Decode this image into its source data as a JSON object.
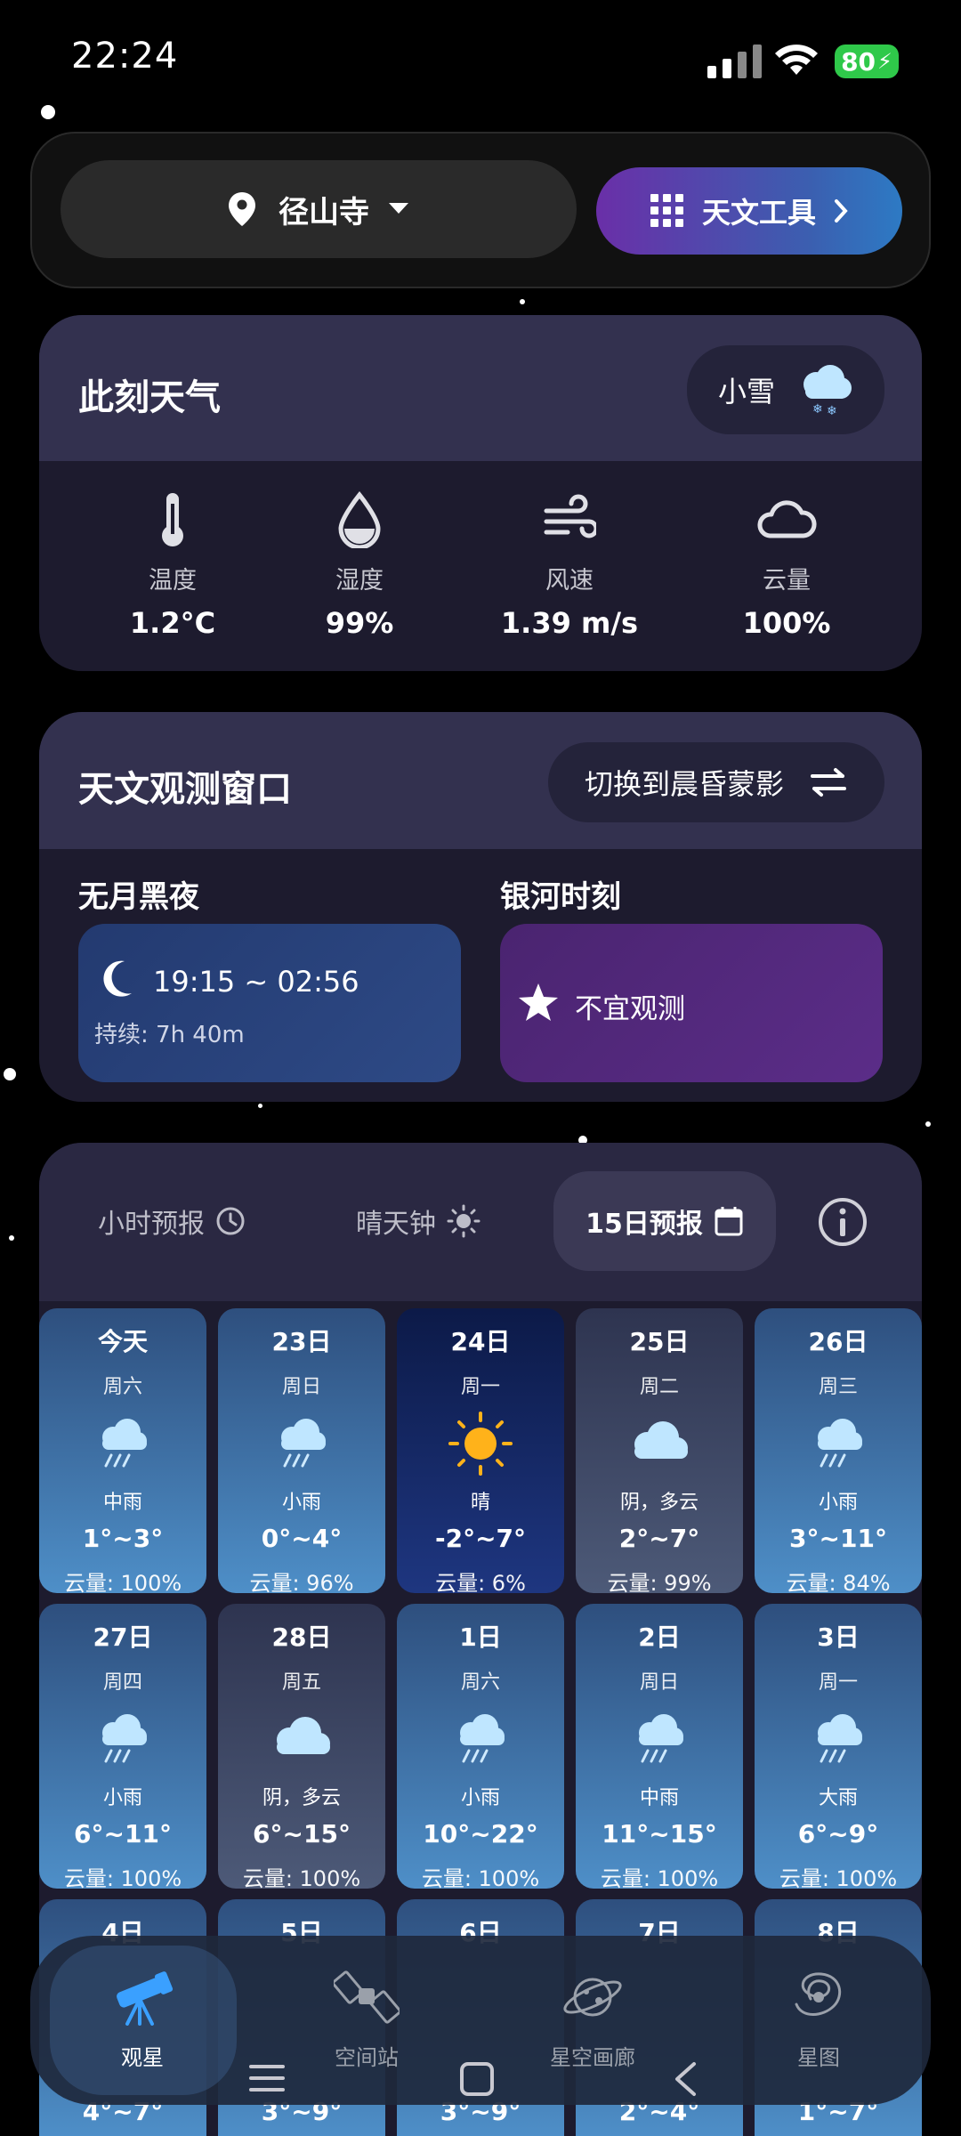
{
  "status": {
    "time": "22:24",
    "battery": "80"
  },
  "topbar": {
    "location": "径山寺",
    "tools_label": "天文工具"
  },
  "weather_now": {
    "title": "此刻天气",
    "condition": "小雪",
    "metrics": [
      {
        "label": "温度",
        "value": "1.2°C",
        "icon": "thermometer-icon"
      },
      {
        "label": "湿度",
        "value": "99%",
        "icon": "humidity-drop-icon"
      },
      {
        "label": "风速",
        "value": "1.39 m/s",
        "icon": "wind-icon"
      },
      {
        "label": "云量",
        "value": "100%",
        "icon": "cloud-icon"
      }
    ]
  },
  "observation": {
    "title": "天文观测窗口",
    "switch_label": "切换到晨昏蒙影",
    "moonless": {
      "title": "无月黑夜",
      "time": "19:15 ~ 02:56",
      "duration": "持续: 7h 40m"
    },
    "milkyway": {
      "title": "银河时刻",
      "status": "不宜观测"
    }
  },
  "forecast": {
    "tabs": [
      "小时预报",
      "晴天钟",
      "15日预报"
    ],
    "active_tab": "15日预报",
    "days": [
      {
        "date": "今天",
        "weekday": "周六",
        "condition": "中雨",
        "temp": "1°~3°",
        "cloud": "云量: 100%",
        "icon": "rain-cloud-icon",
        "style": "blue"
      },
      {
        "date": "23日",
        "weekday": "周日",
        "condition": "小雨",
        "temp": "0°~4°",
        "cloud": "云量: 96%",
        "icon": "rain-cloud-icon",
        "style": "blue"
      },
      {
        "date": "24日",
        "weekday": "周一",
        "condition": "晴",
        "temp": "-2°~7°",
        "cloud": "云量: 6%",
        "icon": "sun-icon",
        "style": "navy"
      },
      {
        "date": "25日",
        "weekday": "周二",
        "condition": "阴，多云",
        "temp": "2°~7°",
        "cloud": "云量: 99%",
        "icon": "cloud-icon",
        "style": "grey"
      },
      {
        "date": "26日",
        "weekday": "周三",
        "condition": "小雨",
        "temp": "3°~11°",
        "cloud": "云量: 84%",
        "icon": "rain-cloud-icon",
        "style": "blue"
      },
      {
        "date": "27日",
        "weekday": "周四",
        "condition": "小雨",
        "temp": "6°~11°",
        "cloud": "云量: 100%",
        "icon": "rain-cloud-icon",
        "style": "blue"
      },
      {
        "date": "28日",
        "weekday": "周五",
        "condition": "阴，多云",
        "temp": "6°~15°",
        "cloud": "云量: 100%",
        "icon": "cloud-icon",
        "style": "grey"
      },
      {
        "date": "1日",
        "weekday": "周六",
        "condition": "小雨",
        "temp": "10°~22°",
        "cloud": "云量: 100%",
        "icon": "rain-cloud-icon",
        "style": "blue"
      },
      {
        "date": "2日",
        "weekday": "周日",
        "condition": "中雨",
        "temp": "11°~15°",
        "cloud": "云量: 100%",
        "icon": "rain-cloud-icon",
        "style": "blue"
      },
      {
        "date": "3日",
        "weekday": "周一",
        "condition": "大雨",
        "temp": "6°~9°",
        "cloud": "云量: 100%",
        "icon": "rain-cloud-icon",
        "style": "blue"
      },
      {
        "date": "4日",
        "weekday": "",
        "condition": "",
        "temp": "4°~7°",
        "cloud": "",
        "icon": "",
        "style": "blue"
      },
      {
        "date": "5日",
        "weekday": "",
        "condition": "",
        "temp": "3°~9°",
        "cloud": "",
        "icon": "",
        "style": "blue"
      },
      {
        "date": "6日",
        "weekday": "",
        "condition": "",
        "temp": "3°~9°",
        "cloud": "",
        "icon": "",
        "style": "blue"
      },
      {
        "date": "7日",
        "weekday": "",
        "condition": "",
        "temp": "2°~4°",
        "cloud": "",
        "icon": "",
        "style": "blue"
      },
      {
        "date": "8日",
        "weekday": "",
        "condition": "",
        "temp": "1°~7°",
        "cloud": "",
        "icon": "",
        "style": "blue"
      }
    ]
  },
  "nav": [
    {
      "label": "观星",
      "icon": "telescope-icon",
      "active": true
    },
    {
      "label": "空间站",
      "icon": "satellite-icon",
      "active": false
    },
    {
      "label": "星空画廊",
      "icon": "planet-icon",
      "active": false
    },
    {
      "label": "星图",
      "icon": "galaxy-icon",
      "active": false
    }
  ],
  "colors": {
    "accent_purple": "#6a2fa8",
    "accent_blue": "#2d7ac4",
    "card_bg": "#1d1b2e",
    "battery_green": "#2fc94a"
  }
}
